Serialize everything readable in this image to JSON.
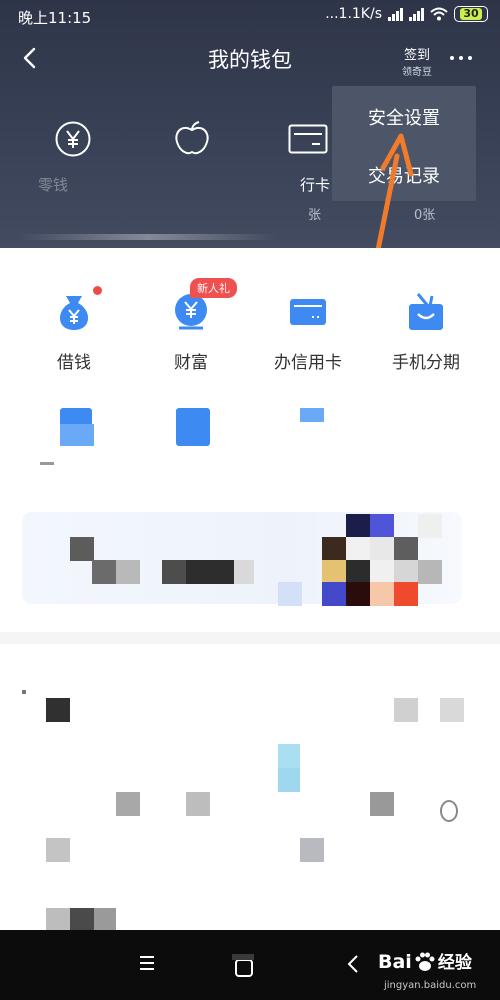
{
  "status_bar": {
    "time": "晚上11:15",
    "network_speed": "...1.1K/s",
    "battery": "30"
  },
  "header": {
    "title": "我的钱包",
    "checkin_label": "签到",
    "checkin_sub": "领奇豆"
  },
  "wallet_stats": {
    "items": [
      {
        "icon": "yuan-circle-icon",
        "label": "零钱",
        "sub": ""
      },
      {
        "icon": "apple-icon",
        "label": "",
        "sub": ""
      },
      {
        "icon": "bank-card-icon",
        "label": "行卡",
        "sub": "张"
      },
      {
        "icon": "",
        "label": "",
        "sub": "0张"
      }
    ]
  },
  "dropdown_menu": {
    "items": [
      "安全设置",
      "交易记录"
    ]
  },
  "services": {
    "items": [
      {
        "label": "借钱",
        "icon": "money-bag-icon",
        "badge": "dot"
      },
      {
        "label": "财富",
        "icon": "piggy-bank-icon",
        "badge": "新人礼"
      },
      {
        "label": "办信用卡",
        "icon": "credit-card-icon",
        "badge": ""
      },
      {
        "label": "手机分期",
        "icon": "shopping-bag-icon",
        "badge": ""
      }
    ]
  },
  "watermark": {
    "brand": "Bai",
    "brand_suffix": "经验",
    "site": "jingyan.baidu.com"
  },
  "colors": {
    "header_bg": "#2e3548",
    "dropdown_bg": "#4d5669",
    "accent_blue": "#3d8bf2",
    "badge_red": "#ef5050",
    "arrow_orange": "#f07b2a"
  }
}
